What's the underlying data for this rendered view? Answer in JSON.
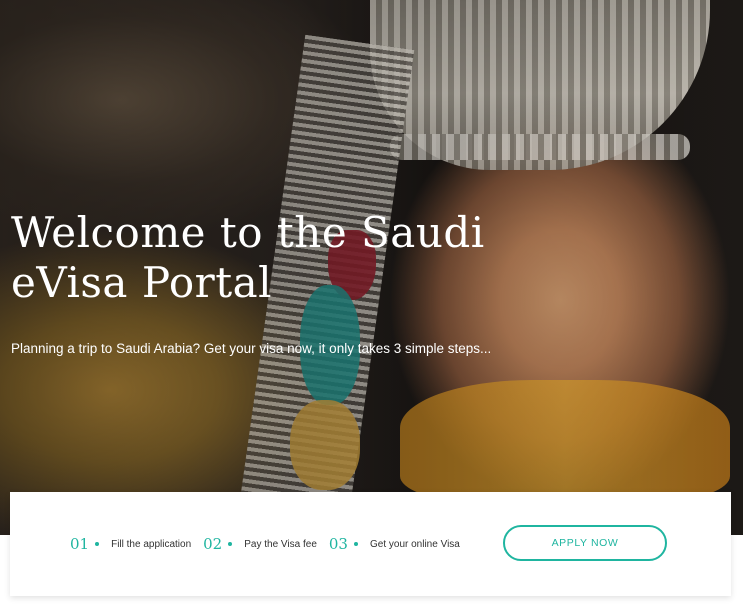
{
  "hero": {
    "title": "Welcome to the Saudi eVisa Portal",
    "subtitle": "Planning a trip to Saudi Arabia? Get your visa now, it only takes 3 simple steps..."
  },
  "steps": [
    {
      "number": "01",
      "label": "Fill the application"
    },
    {
      "number": "02",
      "label": "Pay the Visa fee"
    },
    {
      "number": "03",
      "label": "Get your online Visa"
    }
  ],
  "apply_button": {
    "label": "APPLY NOW"
  },
  "colors": {
    "accent": "#1fb5a0",
    "text_dark": "#333333",
    "card_bg": "#ffffff"
  }
}
